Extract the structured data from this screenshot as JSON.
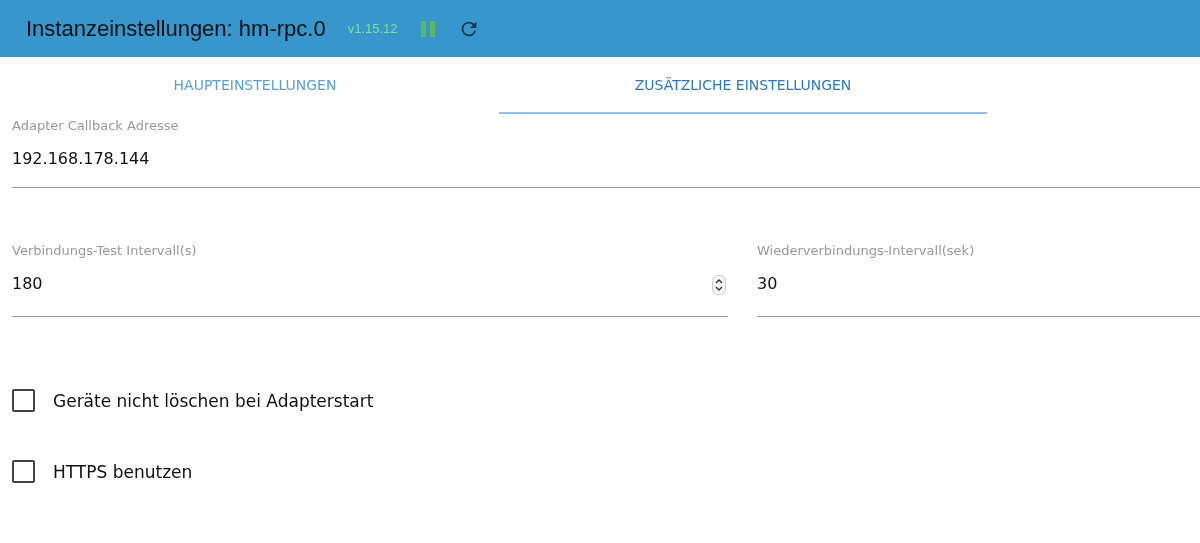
{
  "header": {
    "title": "Instanzeinstellungen: hm-rpc.0",
    "version": "v1.15.12"
  },
  "tabs": [
    {
      "label": "HAUPTEINSTELLUNGEN",
      "selected": false
    },
    {
      "label": "ZUSÄTZLICHE EINSTELLUNGEN",
      "selected": true
    }
  ],
  "callback_field": {
    "label": "Adapter Callback Adresse",
    "value": "192.168.178.144"
  },
  "interval_fields": [
    {
      "label": "Verbindungs-Test Intervall(s)",
      "value": "180",
      "spinner": true
    },
    {
      "label": "Wiederverbindungs-Intervall(sek)",
      "value": "30",
      "spinner": false
    }
  ],
  "checkboxes": [
    {
      "label": "Geräte nicht löschen bei Adapterstart",
      "checked": false
    },
    {
      "label": "HTTPS benutzen",
      "checked": false
    }
  ]
}
